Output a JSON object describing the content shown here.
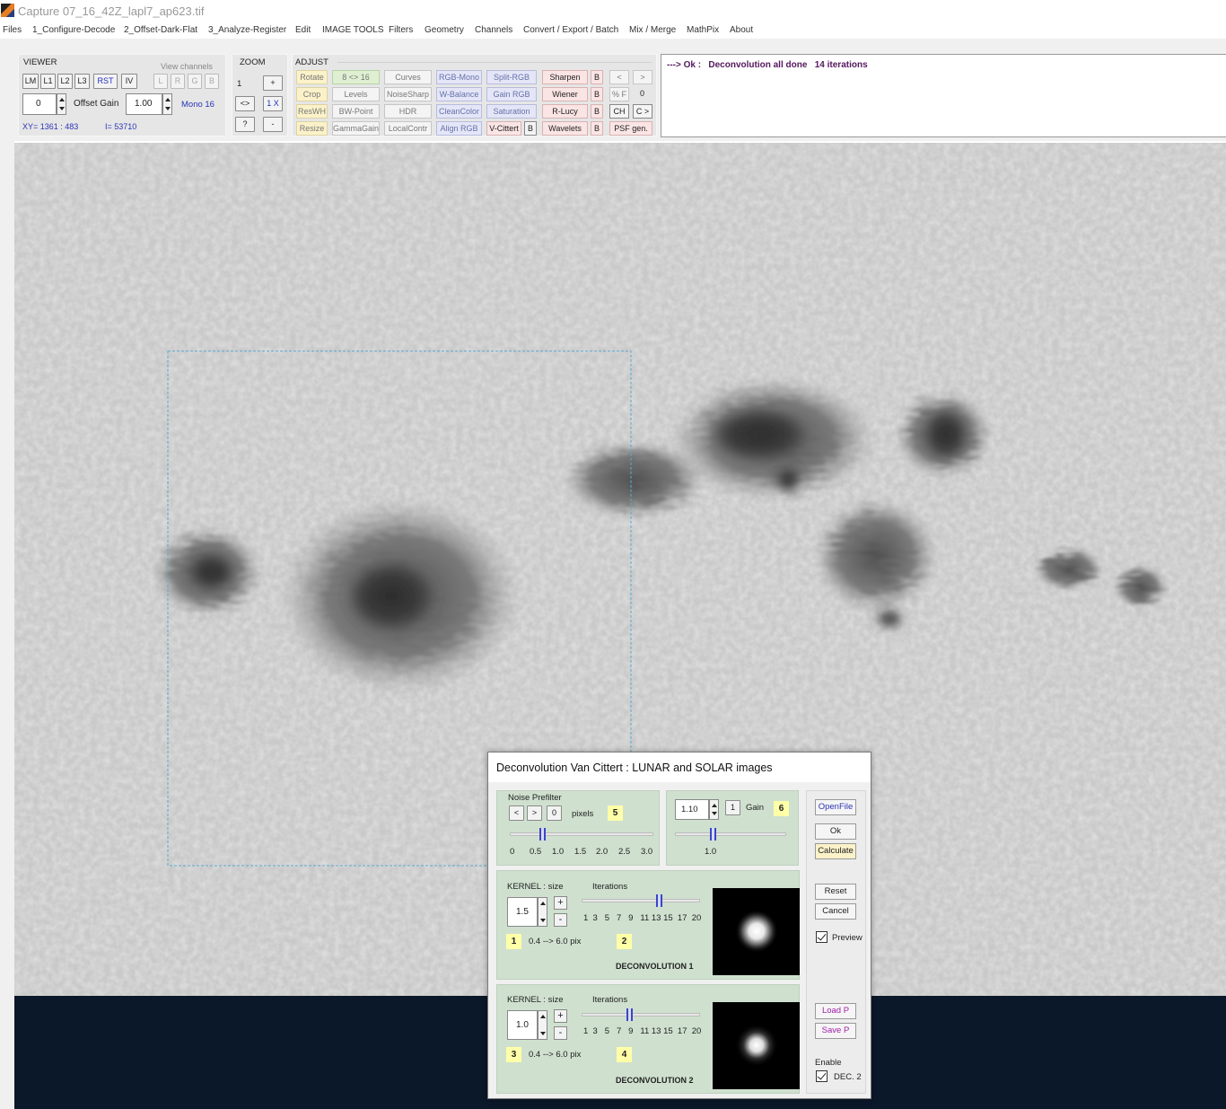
{
  "window": {
    "title": "Capture 07_16_42Z_lapl7_ap623.tif"
  },
  "menu": [
    "Files",
    "1_Configure-Decode",
    "2_Offset-Dark-Flat",
    "3_Analyze-Register",
    "Edit",
    "IMAGE TOOLS",
    "Filters",
    "Geometry",
    "Channels",
    "Convert / Export / Batch",
    "Mix / Merge",
    "MathPix",
    "About"
  ],
  "viewer": {
    "label": "VIEWER",
    "buttons": [
      "LM",
      "L1",
      "L2",
      "L3",
      "RST",
      "IV"
    ],
    "view_channels_label": "View channels",
    "channels": [
      "L",
      "R",
      "G",
      "B"
    ],
    "offset_value": "0",
    "offset_gain_label": "Offset  Gain",
    "gain_value": "1.00",
    "mode": "Mono 16",
    "xy_readout": "XY=  1361 : 483",
    "intensity_readout": "I=  53710"
  },
  "zoom": {
    "label": "ZOOM",
    "level": "1",
    "plus": "+",
    "fit": "<>",
    "onex": "1 X",
    "help": "?",
    "minus": "-"
  },
  "adjust": {
    "label": "ADJUST",
    "col1": [
      "Rotate",
      "Crop",
      "ResWH",
      "Resize"
    ],
    "col2": [
      "8 <> 16",
      "Levels",
      "BW-Point",
      "GammaGain"
    ],
    "col3": [
      "Curves",
      "NoiseSharp",
      "HDR",
      "LocalContr"
    ],
    "col4": [
      "RGB-Mono",
      "W-Balance",
      "CleanColor",
      "Align RGB"
    ],
    "col5": [
      "Split-RGB",
      "Gain RGB",
      "Saturation",
      "V-Cittert"
    ],
    "vcittert_b": "B",
    "col6": [
      "Sharpen",
      "Wiener",
      "R-Lucy",
      "Wavelets"
    ],
    "b_label": "B",
    "nav_prev": "<",
    "nav_next": ">",
    "pctf": "% F",
    "pctf_value": "0",
    "ch": "CH",
    "cnext": "C >",
    "psf": "PSF gen."
  },
  "status": {
    "message": "---> Ok :   Deconvolution all done   14 iterations"
  },
  "dialog": {
    "title": "Deconvolution Van Cittert :  LUNAR and SOLAR images",
    "noise_prefilter_label": "Noise Prefilter",
    "np_prev": "<",
    "np_next": ">",
    "np_zero": "0",
    "pixels_label": "pixels",
    "badge5": "5",
    "np_ticks": [
      "0",
      "0.5",
      "1.0",
      "1.5",
      "2.0",
      "2.5",
      "3.0"
    ],
    "np_value": 0.5,
    "gain_value": "1.10",
    "gain_one": "1",
    "gain_label": "Gain",
    "badge6": "6",
    "gain_tick": "1.0",
    "buttons": {
      "openfile": "OpenFile",
      "ok": "Ok",
      "calculate": "Calculate",
      "reset": "Reset",
      "cancel": "Cancel",
      "loadp": "Load P",
      "savep": "Save P"
    },
    "preview_label": "Preview",
    "enable_label": "Enable",
    "dec2_label": "DEC. 2",
    "kernel1": {
      "kernel_label": "KERNEL :  size",
      "iterations_label": "Iterations",
      "size_value": "1.5",
      "plus": "+",
      "minus": "-",
      "badge_size": "1",
      "range": "0.4 --> 6.0 pix",
      "badge_iter": "2",
      "iter_ticks": "1  3   5   7   9   11 13 15  17  20",
      "iterations": 14,
      "caption": "DECONVOLUTION 1"
    },
    "kernel2": {
      "kernel_label": "KERNEL :  size",
      "iterations_label": "Iterations",
      "size_value": "1.0",
      "plus": "+",
      "minus": "-",
      "badge_size": "3",
      "range": "0.4 --> 6.0 pix",
      "badge_iter": "4",
      "iter_ticks": "1  3   5   7   9   11 13 15  17  20",
      "iterations": 9,
      "caption": "DECONVOLUTION 2"
    }
  },
  "colors": {
    "status_text": "#55185e",
    "dark_area": "#0b1829",
    "panel_green": "#cfe0cf",
    "selection": "#5aa9d6"
  }
}
